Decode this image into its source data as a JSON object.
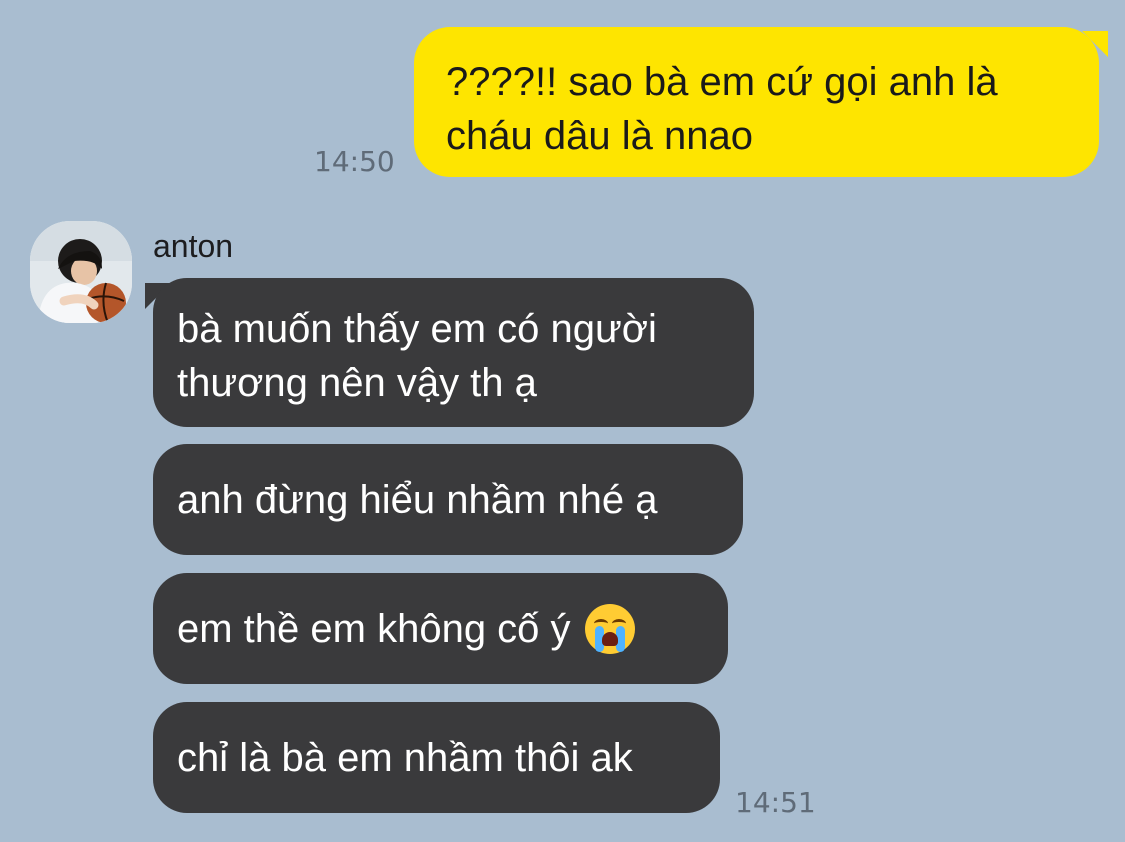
{
  "messages": [
    {
      "id": "m1",
      "side": "out",
      "text_lines": [
        "????!! sao bà em cứ gọi anh là",
        "cháu dâu là nnao"
      ],
      "time": "14:50"
    },
    {
      "id": "m2",
      "side": "in",
      "text_lines": [
        "bà muốn thấy em có người",
        "thương nên vậy th ạ"
      ]
    },
    {
      "id": "m3",
      "side": "in",
      "text": "anh đừng hiểu nhầm nhé ạ"
    },
    {
      "id": "m4",
      "side": "in",
      "text": "em thề em không cố ý",
      "emoji": "loudly-crying-face"
    },
    {
      "id": "m5",
      "side": "in",
      "text": "chỉ là bà em nhầm thôi ak",
      "time": "14:51"
    }
  ],
  "sender": {
    "name": "anton",
    "avatar": "profile-photo-boy-with-basketball"
  },
  "colors": {
    "background": "#a9bdd0",
    "outgoing": "#fee500",
    "incoming": "#3a3a3c",
    "time": "#5f6b78"
  }
}
